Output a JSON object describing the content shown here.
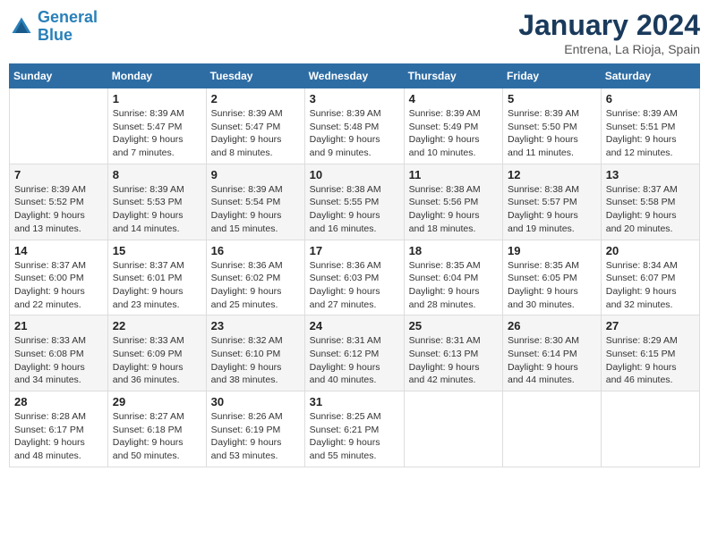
{
  "logo": {
    "line1": "General",
    "line2": "Blue"
  },
  "title": "January 2024",
  "subtitle": "Entrena, La Rioja, Spain",
  "weekdays": [
    "Sunday",
    "Monday",
    "Tuesday",
    "Wednesday",
    "Thursday",
    "Friday",
    "Saturday"
  ],
  "weeks": [
    [
      {
        "day": "",
        "info": ""
      },
      {
        "day": "1",
        "info": "Sunrise: 8:39 AM\nSunset: 5:47 PM\nDaylight: 9 hours\nand 7 minutes."
      },
      {
        "day": "2",
        "info": "Sunrise: 8:39 AM\nSunset: 5:47 PM\nDaylight: 9 hours\nand 8 minutes."
      },
      {
        "day": "3",
        "info": "Sunrise: 8:39 AM\nSunset: 5:48 PM\nDaylight: 9 hours\nand 9 minutes."
      },
      {
        "day": "4",
        "info": "Sunrise: 8:39 AM\nSunset: 5:49 PM\nDaylight: 9 hours\nand 10 minutes."
      },
      {
        "day": "5",
        "info": "Sunrise: 8:39 AM\nSunset: 5:50 PM\nDaylight: 9 hours\nand 11 minutes."
      },
      {
        "day": "6",
        "info": "Sunrise: 8:39 AM\nSunset: 5:51 PM\nDaylight: 9 hours\nand 12 minutes."
      }
    ],
    [
      {
        "day": "7",
        "info": "Sunrise: 8:39 AM\nSunset: 5:52 PM\nDaylight: 9 hours\nand 13 minutes."
      },
      {
        "day": "8",
        "info": "Sunrise: 8:39 AM\nSunset: 5:53 PM\nDaylight: 9 hours\nand 14 minutes."
      },
      {
        "day": "9",
        "info": "Sunrise: 8:39 AM\nSunset: 5:54 PM\nDaylight: 9 hours\nand 15 minutes."
      },
      {
        "day": "10",
        "info": "Sunrise: 8:38 AM\nSunset: 5:55 PM\nDaylight: 9 hours\nand 16 minutes."
      },
      {
        "day": "11",
        "info": "Sunrise: 8:38 AM\nSunset: 5:56 PM\nDaylight: 9 hours\nand 18 minutes."
      },
      {
        "day": "12",
        "info": "Sunrise: 8:38 AM\nSunset: 5:57 PM\nDaylight: 9 hours\nand 19 minutes."
      },
      {
        "day": "13",
        "info": "Sunrise: 8:37 AM\nSunset: 5:58 PM\nDaylight: 9 hours\nand 20 minutes."
      }
    ],
    [
      {
        "day": "14",
        "info": "Sunrise: 8:37 AM\nSunset: 6:00 PM\nDaylight: 9 hours\nand 22 minutes."
      },
      {
        "day": "15",
        "info": "Sunrise: 8:37 AM\nSunset: 6:01 PM\nDaylight: 9 hours\nand 23 minutes."
      },
      {
        "day": "16",
        "info": "Sunrise: 8:36 AM\nSunset: 6:02 PM\nDaylight: 9 hours\nand 25 minutes."
      },
      {
        "day": "17",
        "info": "Sunrise: 8:36 AM\nSunset: 6:03 PM\nDaylight: 9 hours\nand 27 minutes."
      },
      {
        "day": "18",
        "info": "Sunrise: 8:35 AM\nSunset: 6:04 PM\nDaylight: 9 hours\nand 28 minutes."
      },
      {
        "day": "19",
        "info": "Sunrise: 8:35 AM\nSunset: 6:05 PM\nDaylight: 9 hours\nand 30 minutes."
      },
      {
        "day": "20",
        "info": "Sunrise: 8:34 AM\nSunset: 6:07 PM\nDaylight: 9 hours\nand 32 minutes."
      }
    ],
    [
      {
        "day": "21",
        "info": "Sunrise: 8:33 AM\nSunset: 6:08 PM\nDaylight: 9 hours\nand 34 minutes."
      },
      {
        "day": "22",
        "info": "Sunrise: 8:33 AM\nSunset: 6:09 PM\nDaylight: 9 hours\nand 36 minutes."
      },
      {
        "day": "23",
        "info": "Sunrise: 8:32 AM\nSunset: 6:10 PM\nDaylight: 9 hours\nand 38 minutes."
      },
      {
        "day": "24",
        "info": "Sunrise: 8:31 AM\nSunset: 6:12 PM\nDaylight: 9 hours\nand 40 minutes."
      },
      {
        "day": "25",
        "info": "Sunrise: 8:31 AM\nSunset: 6:13 PM\nDaylight: 9 hours\nand 42 minutes."
      },
      {
        "day": "26",
        "info": "Sunrise: 8:30 AM\nSunset: 6:14 PM\nDaylight: 9 hours\nand 44 minutes."
      },
      {
        "day": "27",
        "info": "Sunrise: 8:29 AM\nSunset: 6:15 PM\nDaylight: 9 hours\nand 46 minutes."
      }
    ],
    [
      {
        "day": "28",
        "info": "Sunrise: 8:28 AM\nSunset: 6:17 PM\nDaylight: 9 hours\nand 48 minutes."
      },
      {
        "day": "29",
        "info": "Sunrise: 8:27 AM\nSunset: 6:18 PM\nDaylight: 9 hours\nand 50 minutes."
      },
      {
        "day": "30",
        "info": "Sunrise: 8:26 AM\nSunset: 6:19 PM\nDaylight: 9 hours\nand 53 minutes."
      },
      {
        "day": "31",
        "info": "Sunrise: 8:25 AM\nSunset: 6:21 PM\nDaylight: 9 hours\nand 55 minutes."
      },
      {
        "day": "",
        "info": ""
      },
      {
        "day": "",
        "info": ""
      },
      {
        "day": "",
        "info": ""
      }
    ]
  ]
}
